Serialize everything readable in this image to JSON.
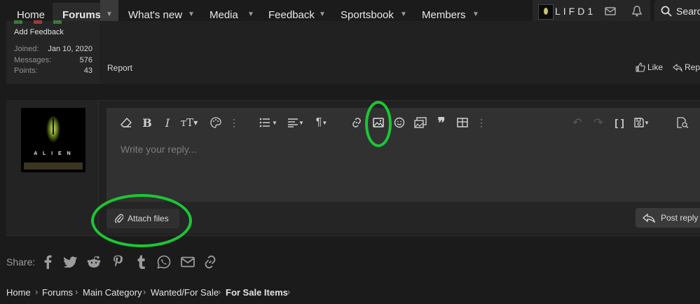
{
  "nav": {
    "items": [
      {
        "label": "Home"
      },
      {
        "label": "Forums"
      },
      {
        "label": "What's new"
      },
      {
        "label": "Media"
      },
      {
        "label": "Feedback"
      },
      {
        "label": "Sportsbook"
      },
      {
        "label": "Members"
      }
    ],
    "username": "LIFD1",
    "search_label": "Search"
  },
  "prev_post": {
    "add_feedback": "Add Feedback",
    "joined_label": "Joined:",
    "joined_value": "Jan 10, 2020",
    "messages_label": "Messages:",
    "messages_value": "576",
    "points_label": "Points:",
    "points_value": "43",
    "report_label": "Report",
    "like_label": "Like",
    "reply_label": "Reply"
  },
  "editor": {
    "placeholder": "Write your reply...",
    "attach_label": "Attach files",
    "post_reply_label": "Post reply",
    "avatar_text": "A L I E N"
  },
  "share": {
    "label": "Share:",
    "icons": [
      "facebook-icon",
      "twitter-icon",
      "reddit-icon",
      "pinterest-icon",
      "tumblr-icon",
      "whatsapp-icon",
      "email-icon",
      "link-icon"
    ]
  },
  "breadcrumb": {
    "items": [
      "Home",
      "Forums",
      "Main Category",
      "Wanted/For Sale",
      "For Sale Items"
    ]
  },
  "colors": {
    "background": "#1b1b1b",
    "editor": "#313131",
    "highlight": "#1bc733"
  }
}
